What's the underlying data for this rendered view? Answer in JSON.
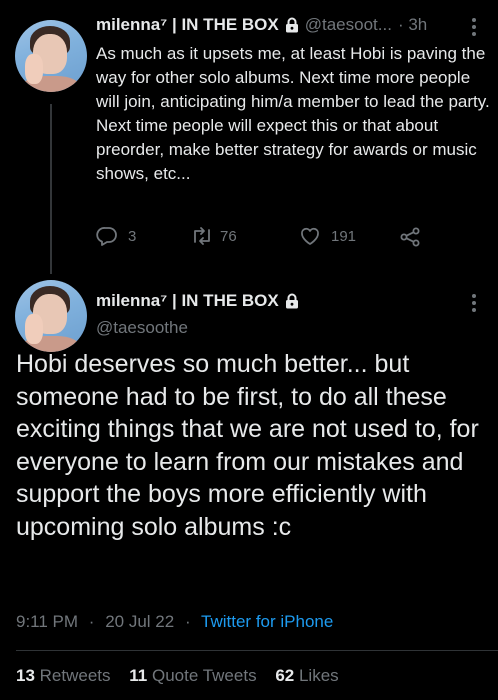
{
  "reply_tweet": {
    "display_name": "milenna⁷ | IN THE BOX",
    "handle": "@taesoot...",
    "time": "· 3h",
    "text": "As much as it upsets me, at least Hobi is paving the way for other solo albums. Next time more people will join, anticipating him/a member to lead the party. Next time people will expect this or that about preorder, make better strategy for awards or music shows, etc...",
    "actions": {
      "replies": "3",
      "retweets": "76",
      "likes": "191"
    },
    "icons": [
      "reply-icon",
      "retweet-icon",
      "like-icon",
      "share-icon",
      "lock-icon",
      "more-icon"
    ]
  },
  "main_tweet": {
    "display_name": "milenna⁷ | IN THE BOX",
    "handle": "@taesoothe",
    "text": "Hobi deserves so much better... but someone had to be first, to do all these exciting things that we are not used to, for everyone to learn from our mistakes and support the boys more efficiently with upcoming solo albums :c",
    "time": "9:11 PM",
    "date": "20 Jul 22",
    "separator": "·",
    "source": "Twitter for iPhone",
    "stats": {
      "retweets_count": "13",
      "retweets_label": "Retweets",
      "quote_count": "11",
      "quote_label": "Quote Tweets",
      "likes_count": "62",
      "likes_label": "Likes"
    }
  },
  "colors": {
    "background": "#000000",
    "text": "#e7e9ea",
    "muted": "#71767b",
    "link": "#1d9bf0",
    "divider": "#2f3336"
  }
}
